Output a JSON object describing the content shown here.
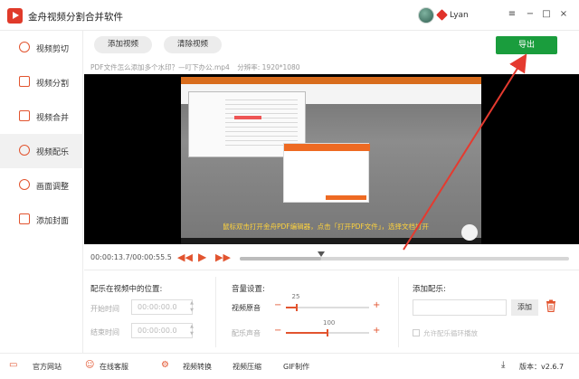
{
  "app": {
    "title": "金舟视频分割合并软件",
    "username": "Lyan"
  },
  "window_controls": [
    "−",
    "□",
    "×"
  ],
  "sidebar": {
    "items": [
      {
        "label": "视频剪切",
        "icon": "scissors-icon"
      },
      {
        "label": "视频分割",
        "icon": "split-icon"
      },
      {
        "label": "视频合并",
        "icon": "merge-icon"
      },
      {
        "label": "视频配乐",
        "icon": "music-icon",
        "active": true
      },
      {
        "label": "画面调整",
        "icon": "picture-adjust-icon"
      },
      {
        "label": "添加封面",
        "icon": "cover-icon"
      }
    ]
  },
  "toolbar": {
    "add_video": "添加视频",
    "clear_video": "清除视频",
    "export": "导出"
  },
  "file_info": {
    "name": "PDF文件怎么添加多个水印？—叮下办公.mp4",
    "resolution_label": "分辨率:",
    "resolution": "1920*1080"
  },
  "video": {
    "caption": "鼠标双击打开金舟PDF编辑器，点击「打开PDF文件」，选择文档打开"
  },
  "playback": {
    "current": "00:00:13.7",
    "total": "00:00:55.5",
    "separator": "/",
    "progress": 0.247
  },
  "music_position": {
    "title": "配乐在视频中的位置:",
    "start_label": "开始时间",
    "end_label": "结束时间",
    "start_value": "00:00:00.0",
    "end_value": "00:00:00.0"
  },
  "volume": {
    "title": "音量设置:",
    "original_label": "视频原音",
    "original_value": 25,
    "music_label": "配乐声音",
    "music_value": 100,
    "max": 200
  },
  "add_music": {
    "title": "添加配乐:",
    "add_button": "添加",
    "loop_label": "允许配乐循环播放",
    "file_value": ""
  },
  "footer": {
    "items": [
      {
        "label": "官方网站",
        "icon": "website-icon"
      },
      {
        "label": "在线客服",
        "icon": "support-icon"
      },
      {
        "label": "视频转换",
        "icon": "convert-icon"
      },
      {
        "label": "视频压缩",
        "icon": ""
      },
      {
        "label": "GIF制作",
        "icon": ""
      }
    ],
    "version_label": "版本：",
    "version": "v2.6.7"
  },
  "colors": {
    "accent": "#e2542f",
    "export_green": "#1a9d3d",
    "arrow_red": "#e53a2f"
  }
}
